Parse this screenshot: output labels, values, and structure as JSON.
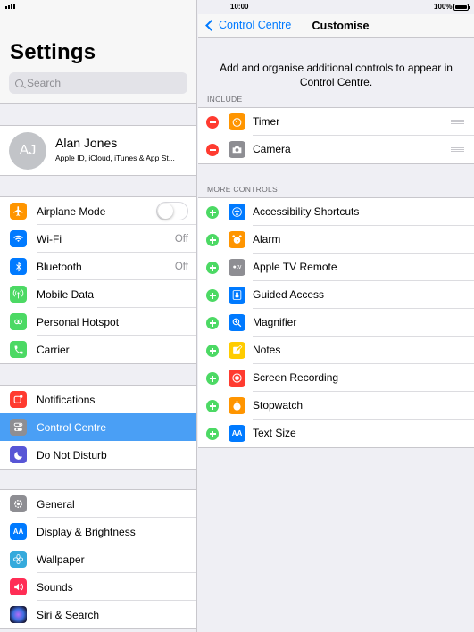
{
  "status_bar": {
    "time": "10:00",
    "battery": "100%"
  },
  "left": {
    "title": "Settings",
    "search_placeholder": "Search",
    "profile": {
      "initials": "AJ",
      "name": "Alan Jones",
      "subtitle": "Apple ID, iCloud, iTunes & App St..."
    },
    "group1": [
      {
        "label": "Airplane Mode",
        "icon": "airplane-icon",
        "color": "#ff9500",
        "toggle": false
      },
      {
        "label": "Wi-Fi",
        "icon": "wifi-icon",
        "color": "#007aff",
        "value": "Off"
      },
      {
        "label": "Bluetooth",
        "icon": "bluetooth-icon",
        "color": "#007aff",
        "value": "Off"
      },
      {
        "label": "Mobile Data",
        "icon": "antenna-icon",
        "color": "#4cd964"
      },
      {
        "label": "Personal Hotspot",
        "icon": "hotspot-icon",
        "color": "#4cd964"
      },
      {
        "label": "Carrier",
        "icon": "phone-icon",
        "color": "#4cd964"
      }
    ],
    "group2": [
      {
        "label": "Notifications",
        "icon": "notifications-icon",
        "color": "#ff3b30"
      },
      {
        "label": "Control Centre",
        "icon": "switches-icon",
        "color": "#8e8e93",
        "selected": true
      },
      {
        "label": "Do Not Disturb",
        "icon": "moon-icon",
        "color": "#5856d6"
      }
    ],
    "group3": [
      {
        "label": "General",
        "icon": "gear-icon",
        "color": "#8e8e93"
      },
      {
        "label": "Display & Brightness",
        "icon": "text-size-icon",
        "color": "#007aff"
      },
      {
        "label": "Wallpaper",
        "icon": "flower-icon",
        "color": "#35aadc"
      },
      {
        "label": "Sounds",
        "icon": "speaker-icon",
        "color": "#ff2d55"
      },
      {
        "label": "Siri & Search",
        "icon": "siri-icon",
        "color": "#2a2a5a"
      }
    ]
  },
  "right": {
    "back_label": "Control Centre",
    "title": "Customise",
    "description": "Add and organise additional controls to appear in Control Centre.",
    "include_header": "INCLUDE",
    "include": [
      {
        "label": "Timer",
        "icon": "timer-icon",
        "color": "#ff9500"
      },
      {
        "label": "Camera",
        "icon": "camera-icon",
        "color": "#8e8e93"
      }
    ],
    "more_header": "MORE CONTROLS",
    "more": [
      {
        "label": "Accessibility Shortcuts",
        "icon": "accessibility-icon",
        "color": "#007aff"
      },
      {
        "label": "Alarm",
        "icon": "alarm-icon",
        "color": "#ff9500"
      },
      {
        "label": "Apple TV Remote",
        "icon": "apple-tv-icon",
        "color": "#8e8e93"
      },
      {
        "label": "Guided Access",
        "icon": "lock-icon",
        "color": "#007aff"
      },
      {
        "label": "Magnifier",
        "icon": "magnifier-icon",
        "color": "#007aff"
      },
      {
        "label": "Notes",
        "icon": "notes-icon",
        "color": "#ffcc00"
      },
      {
        "label": "Screen Recording",
        "icon": "record-icon",
        "color": "#ff3b30"
      },
      {
        "label": "Stopwatch",
        "icon": "stopwatch-icon",
        "color": "#ff9500"
      },
      {
        "label": "Text Size",
        "icon": "text-size-icon",
        "color": "#007aff"
      }
    ]
  }
}
